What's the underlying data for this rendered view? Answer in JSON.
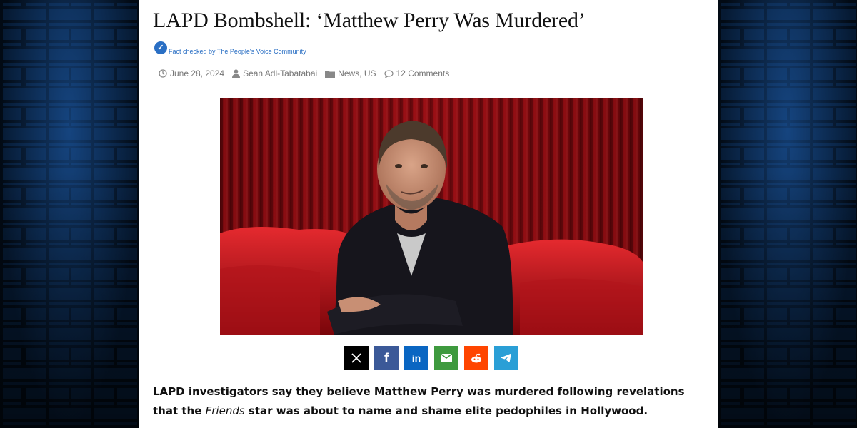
{
  "article": {
    "title": "LAPD Bombshell: ‘Matthew Perry Was Murdered’",
    "fact_check": "Fact checked by The People's Voice Community",
    "date": "June 28, 2024",
    "author": "Sean Adl-Tabatabai",
    "categories": "News, US",
    "comments": "12 Comments",
    "lead_part1": "LAPD investigators say they believe Matthew Perry was murdered following revelations that the",
    "lead_italic": "Friends",
    "lead_part2": "star was about to name and shame elite pedophiles in Hollywood."
  },
  "share_buttons": [
    {
      "name": "x",
      "color": "#000000"
    },
    {
      "name": "facebook",
      "color": "#3b5998"
    },
    {
      "name": "linkedin",
      "color": "#0a66c2"
    },
    {
      "name": "email",
      "color": "#3e9a3e"
    },
    {
      "name": "reddit",
      "color": "#ff4500"
    },
    {
      "name": "telegram",
      "color": "#2a9fd6"
    }
  ],
  "colors": {
    "accent": "#2a6fc4",
    "background_wall": "#061a33",
    "page": "#ffffff"
  },
  "icons": [
    "clock-icon",
    "user-icon",
    "folder-icon",
    "comment-icon",
    "fact-check-icon"
  ]
}
